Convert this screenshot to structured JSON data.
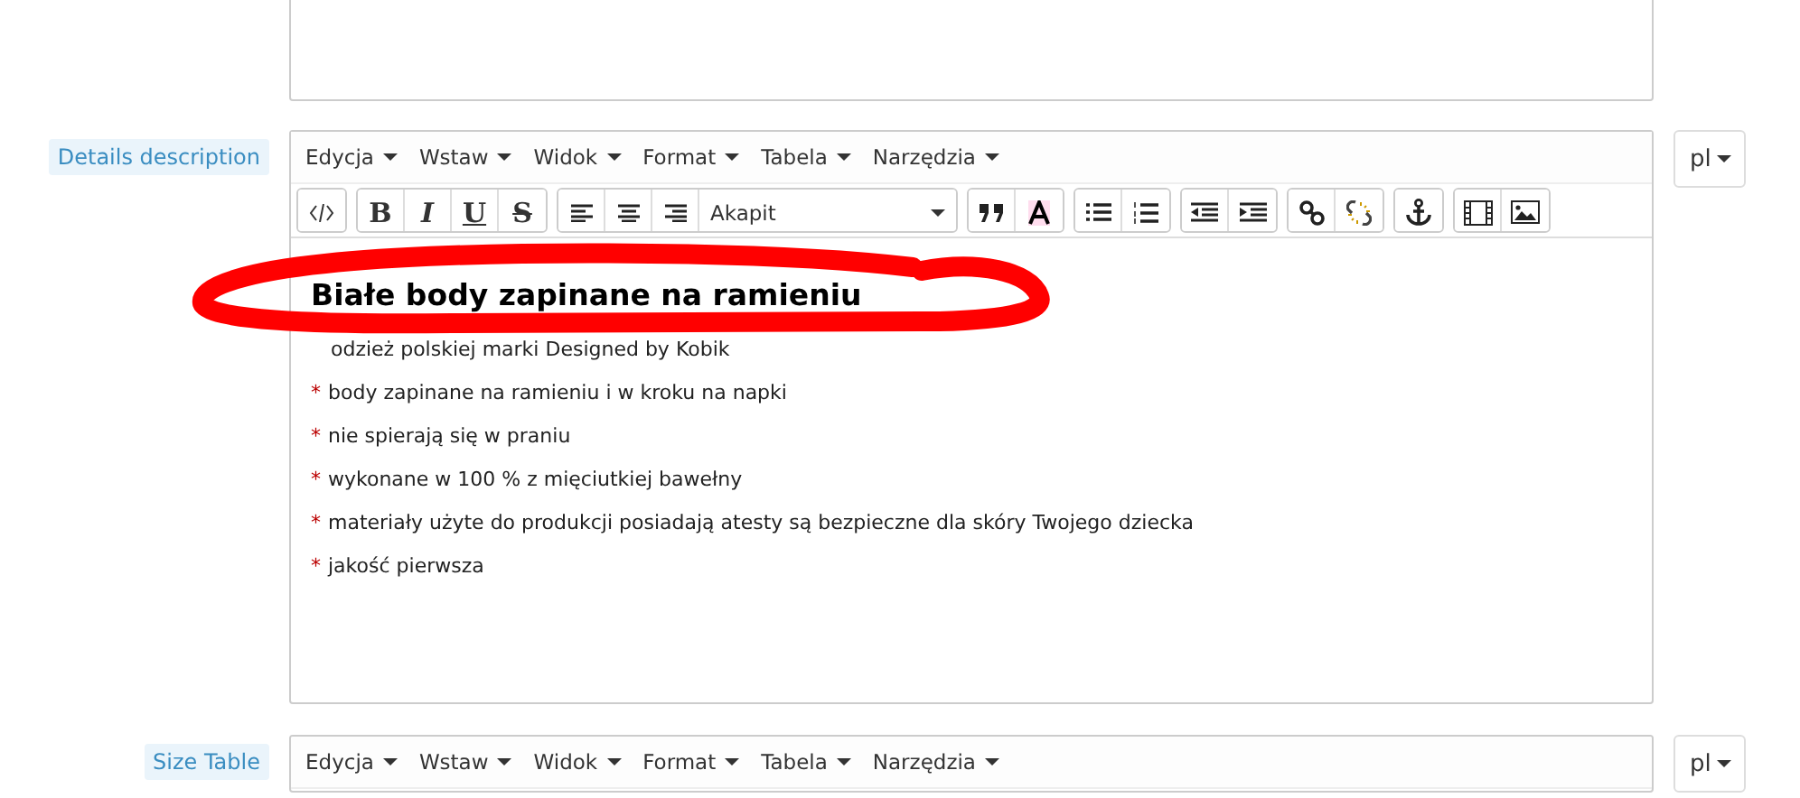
{
  "fields": [
    {
      "label": "Details description",
      "language": "pl",
      "menus": [
        "Edycja",
        "Wstaw",
        "Widok",
        "Format",
        "Tabela",
        "Narzędzia"
      ],
      "toolbar": {
        "text_buttons": [
          "B",
          "I",
          "U",
          "S"
        ],
        "block_format": "Akapit"
      },
      "heading": "Białe body zapinane na ramieniu",
      "lines": [
        {
          "text": "odzież polskiej marki Designed by Kobik"
        },
        {
          "marker": "*",
          "text": "body zapinane na ramieniu i w kroku na napki"
        },
        {
          "marker": "*",
          "text": "nie spierają się w praniu"
        },
        {
          "marker": "*",
          "text": "wykonane w 100 % z mięciutkiej bawełny"
        },
        {
          "marker": "*",
          "text": "materiały użyte do produkcji posiadają atesty są bezpieczne dla skóry Twojego dziecka"
        },
        {
          "marker": "*",
          "text": "jakość pierwsza"
        }
      ]
    },
    {
      "label": "Size Table",
      "language": "pl",
      "menus": [
        "Edycja",
        "Wstaw",
        "Widok",
        "Format",
        "Tabela",
        "Narzędzia"
      ]
    }
  ]
}
